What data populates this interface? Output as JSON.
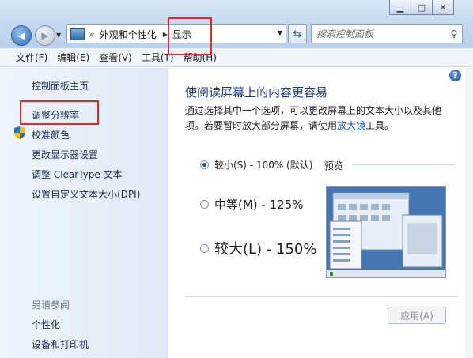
{
  "window": {
    "buttons": [
      "minimize",
      "maximize",
      "close"
    ]
  },
  "address": {
    "separator": "«",
    "crumbs": [
      "外观和个性化",
      "显示"
    ]
  },
  "search": {
    "placeholder": "搜索控制面板"
  },
  "menu": [
    "文件(F)",
    "编辑(E)",
    "查看(V)",
    "工具(T)",
    "帮助(H)"
  ],
  "sidebar": {
    "home": "控制面板主页",
    "items": [
      "调整分辨率",
      "校准颜色",
      "更改显示器设置",
      "调整 ClearType 文本",
      "设置自定义文本大小(DPI)"
    ],
    "see_also_title": "另请参阅",
    "see_also": [
      "个性化",
      "设备和打印机"
    ]
  },
  "main": {
    "title": "使阅读屏幕上的内容更容易",
    "desc_before": "通过选择其中一个选项，可以更改屏幕上的文本大小以及其他项。若要暂时放大部分屏幕，请使用",
    "desc_link": "放大镜",
    "desc_after": "工具。",
    "options": [
      {
        "label": "较小(S) - 100% (默认)",
        "selected": true
      },
      {
        "label": "中等(M) - 125%",
        "selected": false
      },
      {
        "label": "较大(L) - 150%",
        "selected": false
      }
    ],
    "preview_label": "预览",
    "apply_label": "应用(A)"
  },
  "colors": {
    "highlight": "#e0282e",
    "title": "#1e3b82",
    "link": "#1e56b8"
  }
}
